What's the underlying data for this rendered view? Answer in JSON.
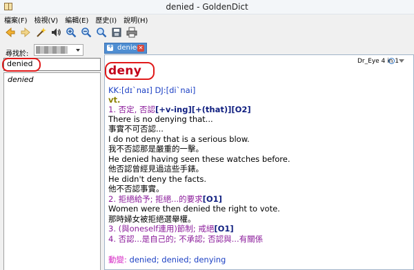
{
  "window": {
    "title": "denied - GoldenDict"
  },
  "menu": [
    "檔案(F)",
    "檢視(V)",
    "編輯(E)",
    "歷史(I)",
    "說明(H)"
  ],
  "toolbar": {
    "icons": [
      "back-arrow-icon",
      "forward-arrow-icon",
      "magic-wand-icon",
      "speaker-icon",
      "zoom-in-icon",
      "zoom-out-icon",
      "zoom-reset-icon",
      "save-icon",
      "print-icon"
    ]
  },
  "left": {
    "lookup_label": "尋找於:",
    "search_value": "denied",
    "word_list": [
      "denied"
    ]
  },
  "tab": {
    "label": "denied"
  },
  "dict_bar": {
    "label": "Dr_Eye 4 in 1"
  },
  "article": {
    "headword": "deny",
    "phonetic": "KK:[dɪ`naɪ] DJ:[di`nai]",
    "pos": "vt.",
    "s1_head_plain": "1. 否定, 否認",
    "s1_head_pattern": "[+v-ing][+(that)][O2]",
    "s1_ex1_en": "There is no denying that...",
    "s1_ex1_zh": "事實不可否認...",
    "s1_ex2_en": "I do not deny that is a serious blow.",
    "s1_ex2_zh": "我不否認那是嚴重的一擊。",
    "s1_ex3_en": "He denied having seen these watches before.",
    "s1_ex3_zh": "他否認曾經見過這些手錶。",
    "s1_ex4_en": "He didn't deny the facts.",
    "s1_ex4_zh": "他不否認事實。",
    "s2_head_plain": "2. 拒絕給予; 拒絕...的要求",
    "s2_head_pattern": "[O1]",
    "s2_ex1_en": "Women were then denied the right to vote.",
    "s2_ex1_zh": "那時婦女被拒絕選舉權。",
    "s3_head_plain": "3. (與oneself連用)節制; 戒絕",
    "s3_head_pattern": "[O1]",
    "s4_head_plain": "4. 否認...是自己的; 不承認; 否認與...有關係",
    "forms_label": "動變:",
    "forms": "denied; denied; denying"
  },
  "colors": {
    "headword": "#c3001a",
    "phonetic": "#1c40c4",
    "pos": "#8c8000",
    "sense": "#8a1a9a",
    "highlight_ring": "#e01818",
    "tab": "#4f8ed2"
  }
}
